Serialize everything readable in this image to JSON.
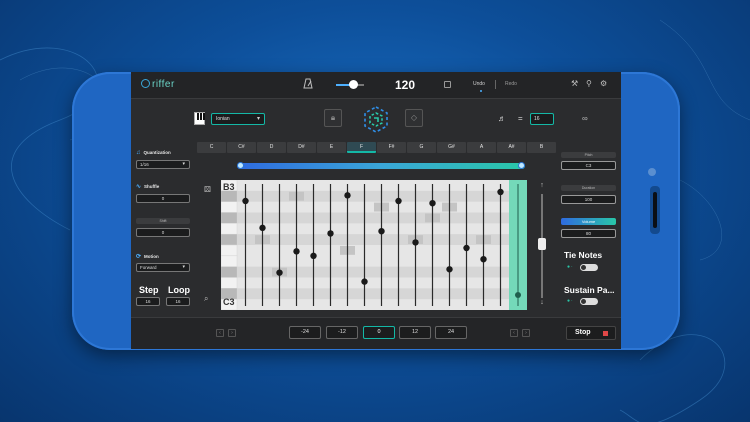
{
  "app": {
    "logo_text": "riffer",
    "tempo": "120",
    "undo_label": "Undo",
    "redo_label": "Redo"
  },
  "toolbar": {
    "scale_value": "Ionian",
    "note_value_symbol": "♬",
    "equals": "=",
    "subdivision_value": "16"
  },
  "keys": [
    "C",
    "C#",
    "D",
    "D#",
    "E",
    "F",
    "F#",
    "G",
    "G#",
    "A",
    "A#",
    "B"
  ],
  "active_key": "F",
  "left": {
    "quantization_label": "Quantization",
    "quantization_value": "1/16",
    "shuffle_label": "Shuffle",
    "shuffle_value": "0",
    "shift_label": "Shift",
    "shift_value": "0",
    "motion_label": "Motion",
    "motion_value": "Forward",
    "step_label": "Step",
    "step_value": "16",
    "loop_label": "Loop",
    "loop_value": "16"
  },
  "grid": {
    "top_note": "B3",
    "bottom_note": "C3",
    "steps": 16,
    "note_levels": [
      0.08,
      0.32,
      0.72,
      0.53,
      0.57,
      0.37,
      0.03,
      0.8,
      0.35,
      0.08,
      0.45,
      0.1,
      0.69,
      0.5,
      0.6,
      0.0
    ],
    "sustain_level": 0.92
  },
  "right": {
    "pitch_label": "Pitch",
    "pitch_value": "C3",
    "duration_label": "Duration",
    "duration_value": "100",
    "volume_label": "Volume",
    "volume_value": "80",
    "tie_notes_label": "Tie Notes",
    "sustain_label": "Sustain Pa..."
  },
  "bottom": {
    "transpose": [
      "-24",
      "-12",
      "0",
      "12",
      "24"
    ],
    "transpose_active": "0",
    "stop_label": "Stop"
  },
  "colors": {
    "accent_teal": "#14b8a6",
    "accent_blue": "#2f6be0",
    "stop_red": "#e04848"
  }
}
